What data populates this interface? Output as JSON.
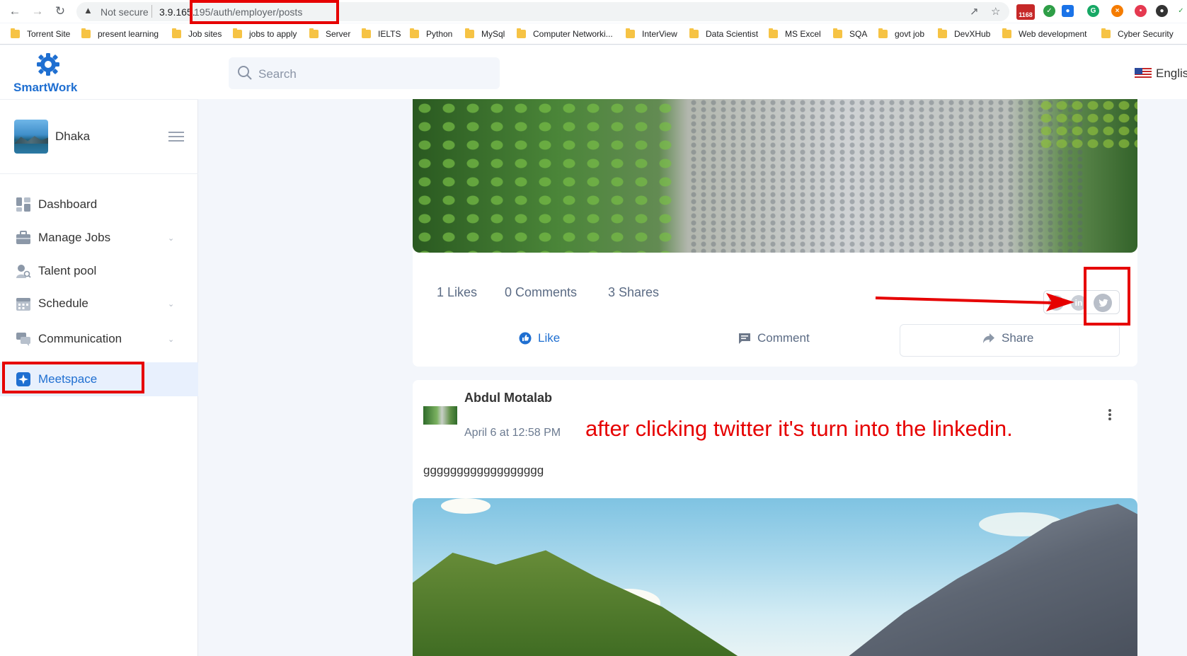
{
  "browser": {
    "security_label": "Not secure",
    "url_host": "3.9.165.",
    "url_path": "195/auth/employer/posts",
    "gmail_count": "1168",
    "bookmarks": [
      "Torrent Site",
      "present learning",
      "Job sites",
      "jobs to apply",
      "Server",
      "IELTS",
      "Python",
      "MySql",
      "Computer Networki...",
      "InterView",
      "Data Scientist",
      "MS Excel",
      "SQA",
      "govt job",
      "DevXHub",
      "Web development",
      "Cyber Security"
    ]
  },
  "app": {
    "logo_text": "SmartWork",
    "search_placeholder": "Search",
    "language": "Englis"
  },
  "sidebar": {
    "profile_name": "Dhaka",
    "items": [
      {
        "label": "Dashboard",
        "icon": "dashboard-icon"
      },
      {
        "label": "Manage Jobs",
        "icon": "briefcase-icon"
      },
      {
        "label": "Talent pool",
        "icon": "user-search-icon"
      },
      {
        "label": "Schedule",
        "icon": "calendar-icon"
      },
      {
        "label": "Communication",
        "icon": "chat-icon"
      },
      {
        "label": "Meetspace",
        "icon": "sparkle-icon"
      }
    ]
  },
  "post1": {
    "likes": "1 Likes",
    "comments": "0 Comments",
    "shares": "3 Shares",
    "like_label": "Like",
    "comment_label": "Comment",
    "share_label": "Share",
    "share_networks": [
      "facebook-icon",
      "linkedin-icon",
      "twitter-icon"
    ]
  },
  "post2": {
    "author": "Abdul Motalab",
    "time": "April 6 at 12:58 PM",
    "body": "gggggggggggggggggg"
  },
  "annotation": {
    "text": "after clicking twitter it's turn into the linkedin."
  },
  "colors": {
    "accent": "#1f6fd1",
    "annotation_red": "#e60000",
    "active_bg": "#e8f0fd"
  }
}
